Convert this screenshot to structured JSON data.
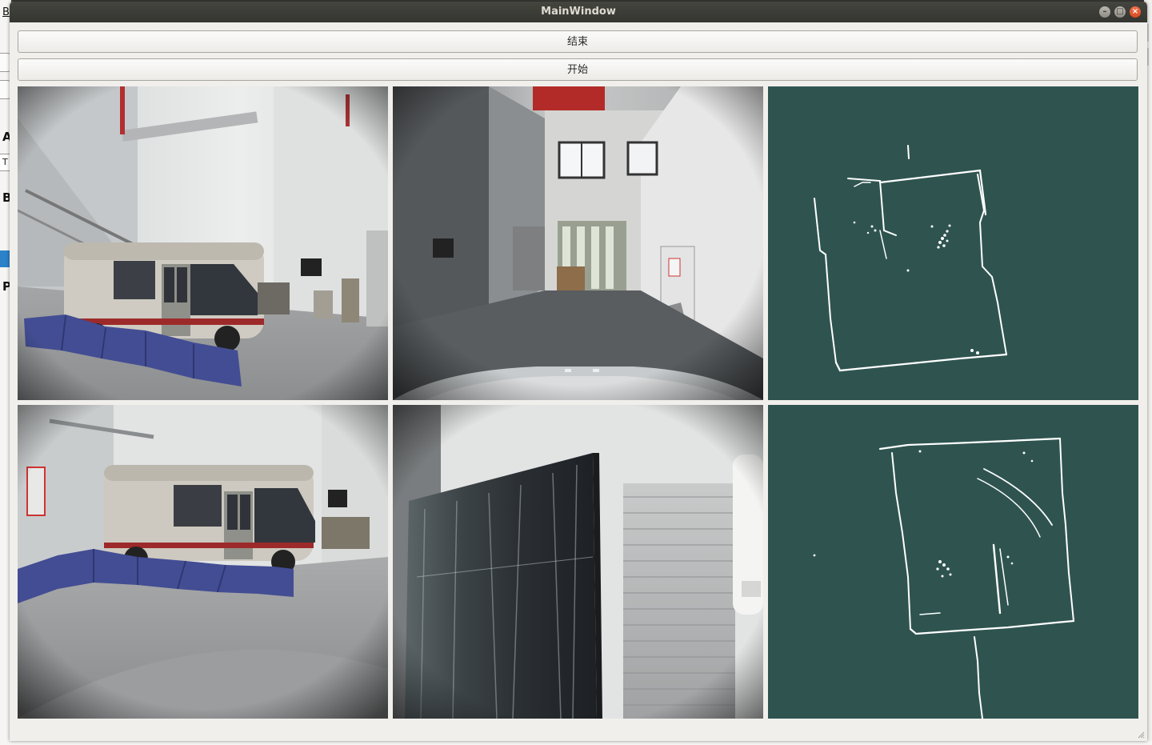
{
  "window": {
    "title": "MainWindow",
    "controls": {
      "minimize": "–",
      "maximize": "□",
      "close": "×"
    }
  },
  "buttons": {
    "end_label": "结束",
    "start_label": "开始"
  },
  "background_app": {
    "letters": [
      "A",
      "B",
      "P"
    ],
    "field_prefix": "T",
    "partial_top_text": "B"
  },
  "panels": {
    "top": [
      "camera-front-left",
      "camera-front",
      "lidar-map-upper"
    ],
    "bottom": [
      "camera-rear-left",
      "camera-right",
      "lidar-map-lower"
    ]
  },
  "colors": {
    "map_background": "#2f5450",
    "map_points": "#ffffff",
    "title_bar": "#3c3c38",
    "close_button": "#e8592c",
    "background_app_accent": "#2b82c9"
  }
}
